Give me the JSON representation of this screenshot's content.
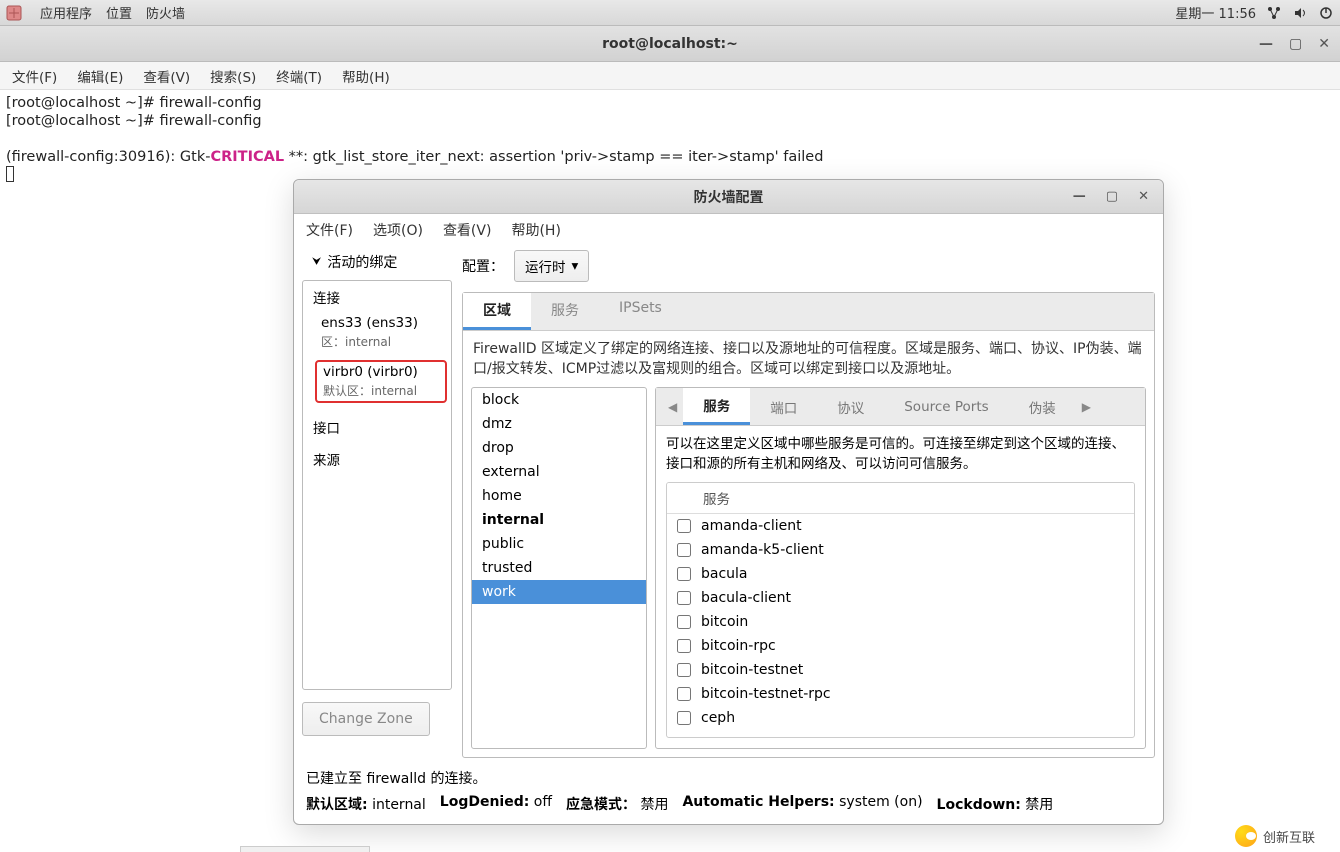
{
  "gnome": {
    "apps": "应用程序",
    "places": "位置",
    "firewall": "防火墙",
    "clock": "星期一 11:56"
  },
  "terminal": {
    "title": "root@localhost:~",
    "menu": {
      "file": "文件(F)",
      "edit": "编辑(E)",
      "view": "查看(V)",
      "search": "搜索(S)",
      "terminal": "终端(T)",
      "help": "帮助(H)"
    },
    "line1_prompt": "[root@localhost ~]# ",
    "line1_cmd": "firewall-config",
    "line2_prompt": "[root@localhost ~]# ",
    "line2_cmd": "firewall-config",
    "err_prefix": "(firewall-config:30916): Gtk-",
    "err_word": "CRITICAL",
    "err_suffix": " **: gtk_list_store_iter_next: assertion 'priv->stamp == iter->stamp' failed"
  },
  "fw": {
    "title": "防火墙配置",
    "menu": {
      "file": "文件(F)",
      "options": "选项(O)",
      "view": "查看(V)",
      "help": "帮助(H)"
    },
    "active_bindings": "活动的绑定",
    "left": {
      "connections": "连接",
      "ens33": "ens33 (ens33)",
      "ens33_zone": "区：internal",
      "virbr0": "virbr0 (virbr0)",
      "virbr0_zone": "默认区：internal",
      "interfaces": "接口",
      "sources": "来源"
    },
    "change_zone": "Change Zone",
    "config_label": "配置：",
    "config_value": "运行时",
    "tabs": {
      "zones": "区域",
      "services": "服务",
      "ipsets": "IPSets"
    },
    "zone_desc": "FirewallD 区域定义了绑定的网络连接、接口以及源地址的可信程度。区域是服务、端口、协议、IP伪装、端口/报文转发、ICMP过滤以及富规则的组合。区域可以绑定到接口以及源地址。",
    "zones": [
      "block",
      "dmz",
      "drop",
      "external",
      "home",
      "internal",
      "public",
      "trusted",
      "work"
    ],
    "zone_active": "internal",
    "zone_selected": "work",
    "detail_tabs": {
      "services": "服务",
      "ports": "端口",
      "protocols": "协议",
      "source_ports": "Source Ports",
      "masq": "伪装"
    },
    "detail_desc": "可以在这里定义区域中哪些服务是可信的。可连接至绑定到这个区域的连接、接口和源的所有主机和网络及、可以访问可信服务。",
    "svc_header": "服务",
    "services_list": [
      "amanda-client",
      "amanda-k5-client",
      "bacula",
      "bacula-client",
      "bitcoin",
      "bitcoin-rpc",
      "bitcoin-testnet",
      "bitcoin-testnet-rpc",
      "ceph"
    ],
    "status_connected": "已建立至 firewalld 的连接。",
    "status_bar": {
      "default_zone_label": "默认区域:",
      "default_zone": "internal",
      "logdenied_label": "LogDenied:",
      "logdenied": "off",
      "panic_label": "应急模式：",
      "panic": "禁用",
      "auto_label": "Automatic Helpers:",
      "auto": "system (on)",
      "lockdown_label": "Lockdown:",
      "lockdown": "禁用"
    }
  },
  "logo": "创新互联"
}
